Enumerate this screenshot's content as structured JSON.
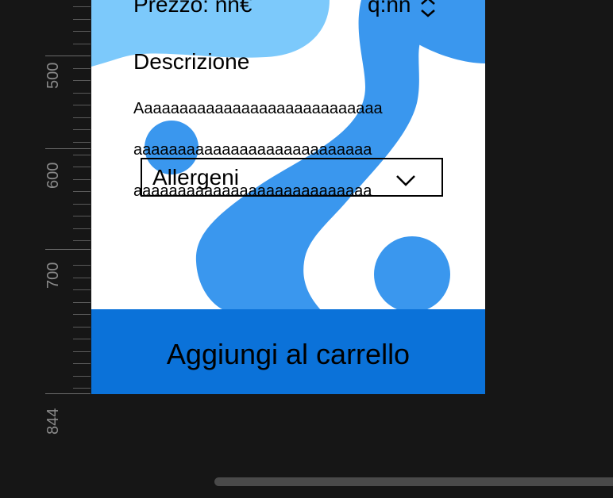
{
  "ruler": {
    "labels": [
      "500",
      "600",
      "700"
    ],
    "end_label": "844"
  },
  "product": {
    "price_text": "Prezzo: nn€",
    "qty_text": "q:nn",
    "description_title": "Descrizione",
    "description_lines": [
      "Aaaaaaaaaaaaaaaaaaaaaaaaaaaa",
      "aaaaaaaaaaaaaaaaaaaaaaaaaaa",
      "aaaaaaaaaaaaaaaaaaaaaaaaaaa"
    ]
  },
  "allergens": {
    "label": "Allergeni"
  },
  "cart_button": {
    "label": "Aggiungi al carrello"
  },
  "colors": {
    "canvas": "#161616",
    "artboard": "#ffffff",
    "blob_light": "#7cc9fb",
    "blob_mid": "#3a97ee",
    "button": "#0b72d9"
  },
  "icons": {
    "qty": "chevron-up-down-icon",
    "allergens": "chevron-down-icon"
  }
}
